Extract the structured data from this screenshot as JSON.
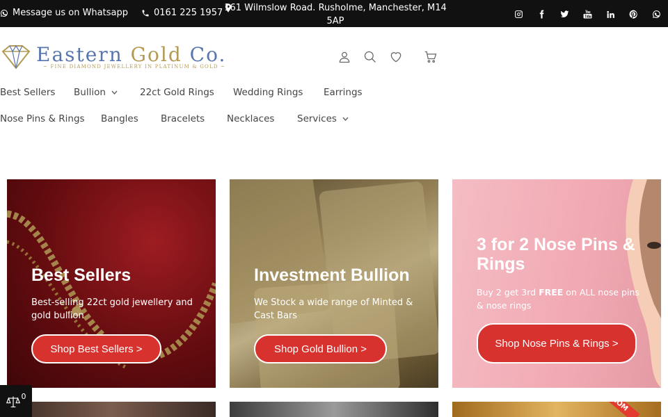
{
  "topbar": {
    "whatsapp_label": "Message us on Whatsapp",
    "phone": "0161 225 1957",
    "address": "161 Wilmslow Road. Rusholme, Manchester, M14 5AP",
    "socials": [
      "instagram-icon",
      "facebook-icon",
      "twitter-icon",
      "youtube-icon",
      "linkedin-icon",
      "pinterest-icon",
      "whatsapp-icon"
    ]
  },
  "logo": {
    "name_part1": "Eastern ",
    "name_part2": "Gold",
    "name_part3": " Co.",
    "tagline": "~ FINE DIAMOND JEWELLERY IN PLATINUM & GOLD ~"
  },
  "nav": {
    "row1": [
      {
        "label": "Best Sellers",
        "dropdown": false
      },
      {
        "label": "Bullion",
        "dropdown": true
      },
      {
        "label": "22ct Gold Rings",
        "dropdown": false
      },
      {
        "label": "Wedding Rings",
        "dropdown": false
      },
      {
        "label": "Earrings",
        "dropdown": false
      }
    ],
    "row2": [
      {
        "label": "Nose Pins & Rings",
        "dropdown": false
      },
      {
        "label": "Bangles",
        "dropdown": false
      },
      {
        "label": "Bracelets",
        "dropdown": false
      },
      {
        "label": "Necklaces",
        "dropdown": false
      },
      {
        "label": "Services",
        "dropdown": true
      }
    ]
  },
  "cards": [
    {
      "title": "Best Sellers",
      "desc": "Best-selling 22ct gold jewellery and gold bullion",
      "button": "Shop Best Sellers >"
    },
    {
      "title": "Investment Bullion",
      "desc": "We Stock a wide range of Minted & Cast Bars",
      "button": "Shop Gold Bullion >"
    },
    {
      "title": "3 for 2 Nose Pins & Rings",
      "desc_before": "Buy 2 get 3rd ",
      "desc_bold": "FREE",
      "desc_after": " on ALL nose pins & nose rings",
      "button": "Shop Nose Pins & Rings >"
    }
  ],
  "bottom": {
    "ribbon": "COM"
  },
  "compare": {
    "count": "0"
  },
  "colors": {
    "topbar_bg": "#111111",
    "accent_button": "#d8322f",
    "logo_blue": "#5876ae",
    "logo_gold": "#b39a55"
  }
}
